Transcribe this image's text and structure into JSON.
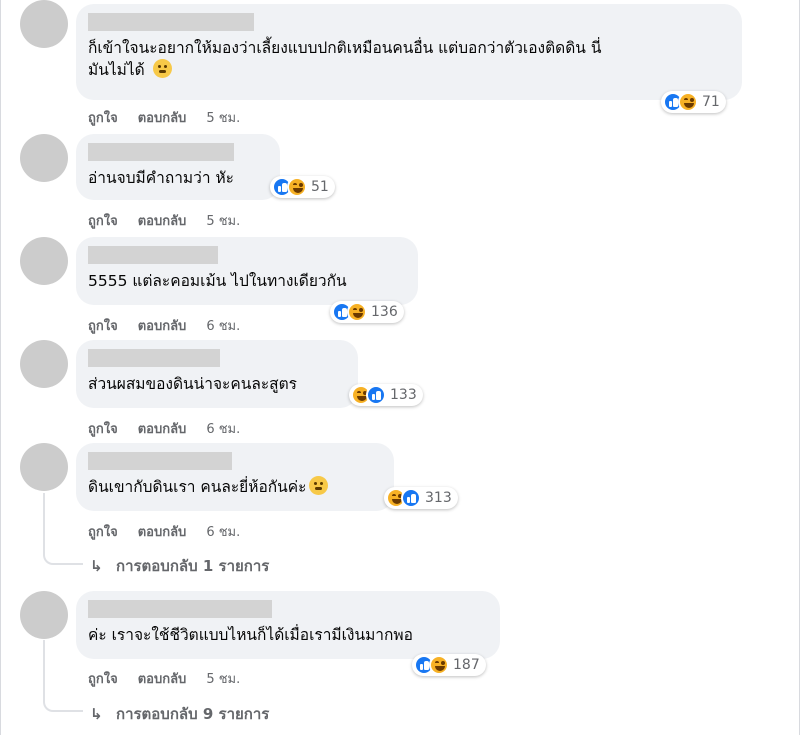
{
  "actions": {
    "like_label": "ถูกใจ",
    "reply_label": "ตอบกลับ"
  },
  "comments": [
    {
      "text_line1": "ก็เข้าใจนะอยากให้มองว่าเลี้ยงแบบปกติเหมือนคนอื่น แต่บอกว่าตัวเองติดดิน นี่",
      "text_line2": "มันไม่ได้",
      "inline_emoji": "slightly-smiling-face",
      "reactions": [
        "like",
        "haha"
      ],
      "count": "71",
      "time": "5 ชม."
    },
    {
      "text": "อ่านจบมีคำถามว่า หัะ",
      "reactions": [
        "like",
        "haha"
      ],
      "count": "51",
      "time": "5 ชม."
    },
    {
      "text": "5555 แต่ละคอมเม้น ไปในทางเดียวกัน",
      "reactions": [
        "like",
        "haha"
      ],
      "count": "136",
      "time": "6 ชม."
    },
    {
      "text": "ส่วนผสมของดินน่าจะคนละสูตร",
      "reactions": [
        "haha",
        "like"
      ],
      "count": "133",
      "time": "6 ชม."
    },
    {
      "text": "ดินเขากับดินเรา คนละยี่ห้อกันค่ะ",
      "inline_emoji": "grimacing-face",
      "reactions": [
        "haha",
        "like"
      ],
      "count": "313",
      "time": "6 ชม.",
      "replies": "การตอบกลับ 1 รายการ"
    },
    {
      "text": "ค่ะ เราจะใช้ชีวิตแบบไหนก็ได้เมื่อเรามีเงินมากพอ",
      "reactions": [
        "like",
        "haha"
      ],
      "count": "187",
      "time": "5 ชม.",
      "replies": "การตอบกลับ 9 รายการ"
    }
  ],
  "colors": {
    "bubble": "#f0f2f5",
    "like": "#1877f2",
    "haha": "#f7b125",
    "meta": "#65676b"
  }
}
